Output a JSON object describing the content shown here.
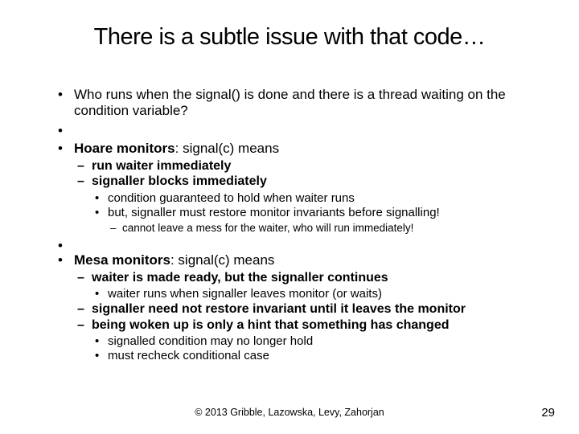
{
  "title": "There is a subtle issue with that code…",
  "b1": {
    "text": "Who runs when the signal() is done and there is a thread waiting on the condition variable?"
  },
  "b2": {
    "label_bold": "Hoare monitors",
    "label_rest": ":  signal(c) means",
    "s1": "run waiter immediately",
    "s2": "signaller blocks immediately",
    "t1": "condition guaranteed to hold when waiter runs",
    "t2": "but, signaller must restore monitor invariants before signalling!",
    "u1": "cannot leave a mess for the waiter, who will run immediately!"
  },
  "b3": {
    "label_bold": "Mesa monitors",
    "label_rest": ":  signal(c) means",
    "s1": "waiter is made ready, but the signaller continues",
    "t1": "waiter runs when signaller leaves monitor (or waits)",
    "s2": "signaller need not restore invariant until it leaves the monitor",
    "s3": "being woken up is only a hint that something has changed",
    "t2": "signalled condition may no longer hold",
    "t3": "must recheck conditional case"
  },
  "footer": "© 2013 Gribble, Lazowska, Levy, Zahorjan",
  "page": "29"
}
